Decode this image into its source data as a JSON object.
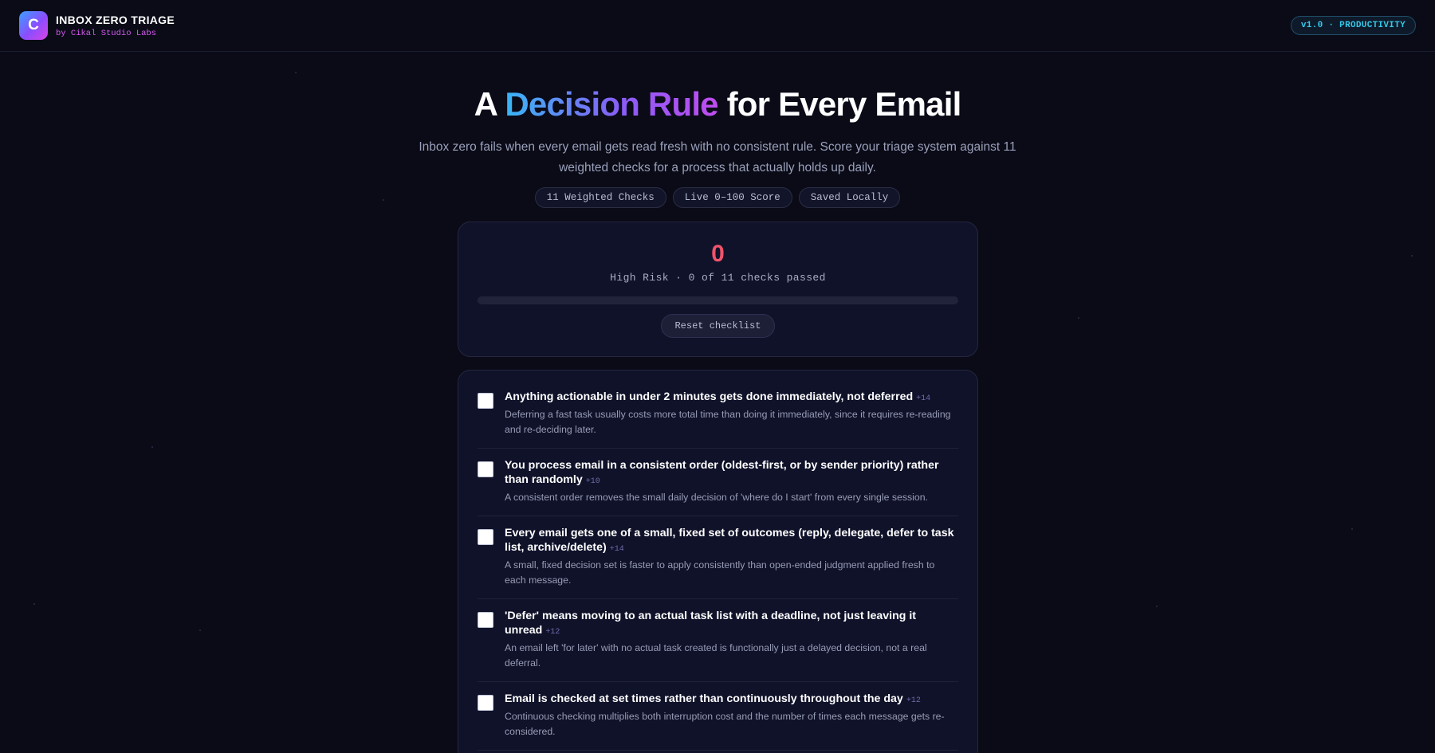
{
  "app": {
    "logo_letter": "C",
    "title": "INBOX ZERO TRIAGE",
    "subtitle": "by Cikal Studio Labs",
    "version_badge": "v1.0 · PRODUCTIVITY"
  },
  "hero": {
    "title_pre": "A ",
    "title_accent": "Decision Rule",
    "title_post": " for Every Email",
    "lede": "Inbox zero fails when every email gets read fresh with no consistent rule. Score your triage system against 11 weighted checks for a process that actually holds up daily.",
    "pills": [
      "11 Weighted Checks",
      "Live 0–100 Score",
      "Saved Locally"
    ]
  },
  "score": {
    "value": "0",
    "label": "High Risk · 0 of 11 checks passed",
    "progress_fraction": 0,
    "reset_label": "Reset checklist"
  },
  "checklist": [
    {
      "title": "Anything actionable in under 2 minutes gets done immediately, not deferred",
      "weight": "+14",
      "desc": "Deferring a fast task usually costs more total time than doing it immediately, since it requires re-reading and re-deciding later."
    },
    {
      "title": "You process email in a consistent order (oldest-first, or by sender priority) rather than randomly",
      "weight": "+10",
      "desc": "A consistent order removes the small daily decision of 'where do I start' from every single session."
    },
    {
      "title": "Every email gets one of a small, fixed set of outcomes (reply, delegate, defer to task list, archive/delete)",
      "weight": "+14",
      "desc": "A small, fixed decision set is faster to apply consistently than open-ended judgment applied fresh to each message."
    },
    {
      "title": "'Defer' means moving to an actual task list with a deadline, not just leaving it unread",
      "weight": "+12",
      "desc": "An email left 'for later' with no actual task created is functionally just a delayed decision, not a real deferral."
    },
    {
      "title": "Email is checked at set times rather than continuously throughout the day",
      "weight": "+12",
      "desc": "Continuous checking multiplies both interruption cost and the number of times each message gets re-considered."
    }
  ],
  "colors": {
    "background": "#0a0b17",
    "card": "#10122a",
    "score_risk": "#f0546a",
    "accent_cyan": "#35c7e8",
    "accent_magenta": "#d558f0"
  }
}
